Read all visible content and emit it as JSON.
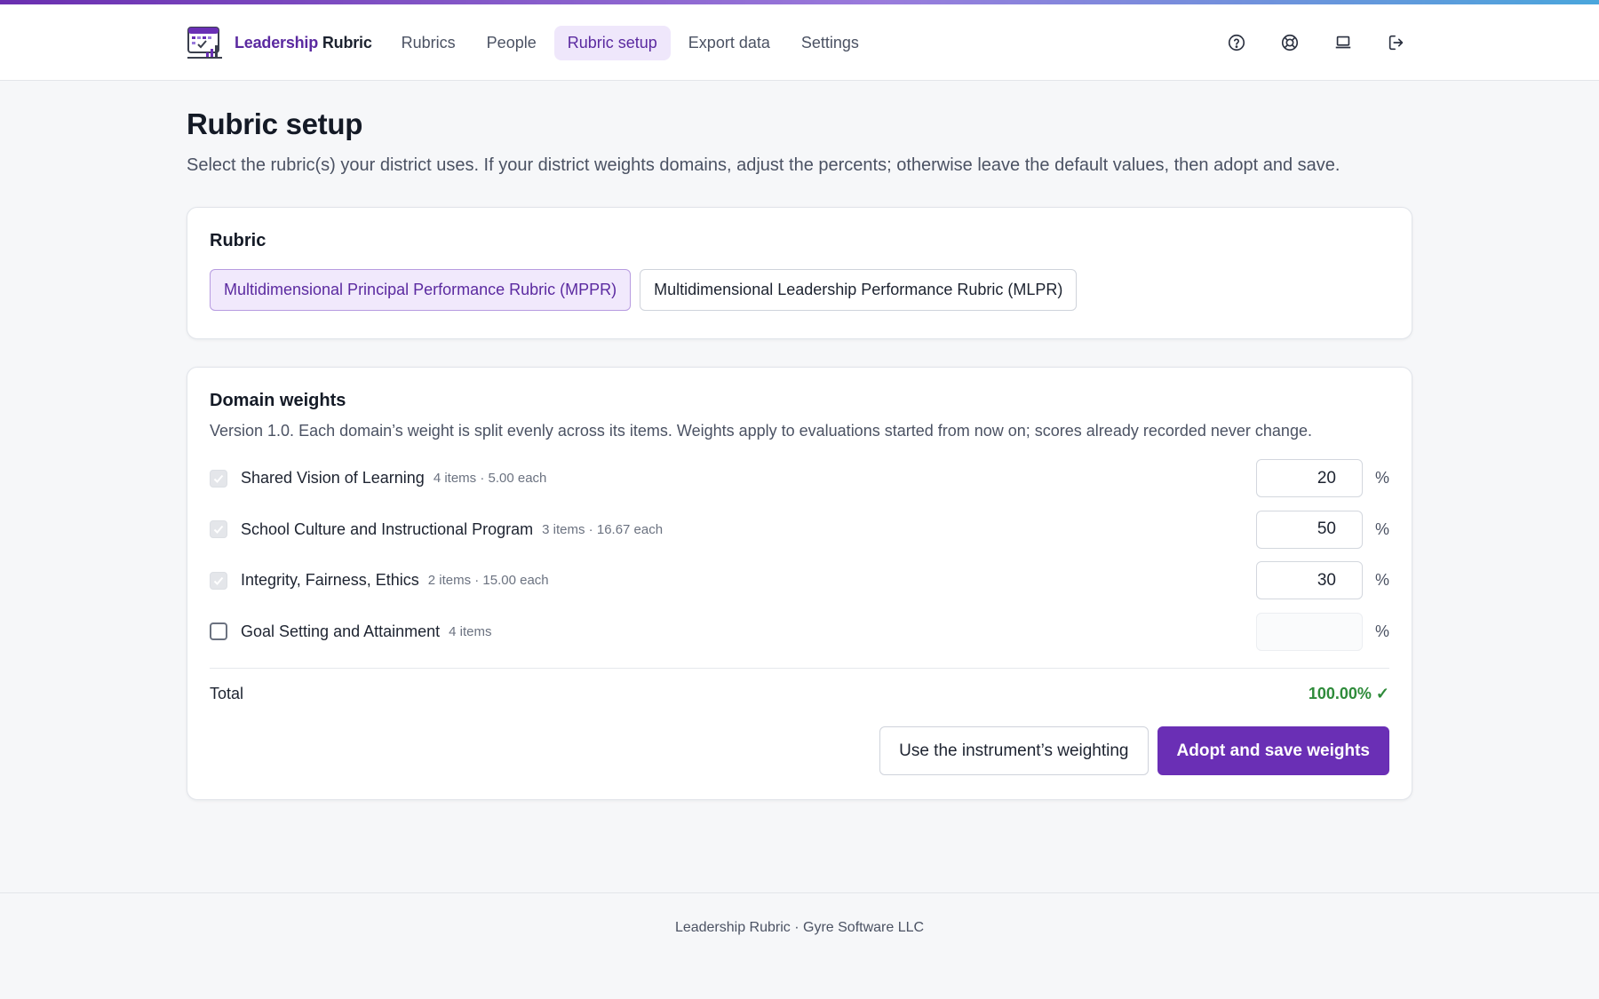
{
  "brand": {
    "name_part1": "Leadership",
    "name_part2": "Rubric",
    "logo_icon": "rubric-chart-logo"
  },
  "nav": {
    "items": [
      {
        "label": "Rubrics",
        "active": false
      },
      {
        "label": "People",
        "active": false
      },
      {
        "label": "Rubric setup",
        "active": true
      },
      {
        "label": "Export data",
        "active": false
      },
      {
        "label": "Settings",
        "active": false
      }
    ]
  },
  "header_icons": [
    "help-icon",
    "support-icon",
    "laptop-icon",
    "logout-icon"
  ],
  "page": {
    "title": "Rubric setup",
    "description": "Select the rubric(s) your district uses. If your district weights domains, adjust the percents; otherwise leave the default values, then adopt and save."
  },
  "rubric_card": {
    "title": "Rubric",
    "options": [
      {
        "label": "Multidimensional Principal Performance Rubric (MPPR)",
        "selected": true
      },
      {
        "label": "Multidimensional Leadership Performance Rubric (MLPR)",
        "selected": false
      }
    ]
  },
  "weights_card": {
    "title": "Domain weights",
    "description": "Version 1.0. Each domain’s weight is split evenly across its items. Weights apply to evaluations started from now on; scores already recorded never change.",
    "domains": [
      {
        "name": "Shared Vision of Learning",
        "meta": "4 items · 5.00 each",
        "checked": true,
        "weight": "20"
      },
      {
        "name": "School Culture and Instructional Program",
        "meta": "3 items · 16.67 each",
        "checked": true,
        "weight": "50"
      },
      {
        "name": "Integrity, Fairness, Ethics",
        "meta": "2 items · 15.00 each",
        "checked": true,
        "weight": "30"
      },
      {
        "name": "Goal Setting and Attainment",
        "meta": "4 items",
        "checked": false,
        "weight": ""
      }
    ],
    "percent_symbol": "%",
    "total_label": "Total",
    "total_value": "100.00% ✓",
    "secondary_button": "Use the instrument’s weighting",
    "primary_button": "Adopt and save weights"
  },
  "footer": {
    "text": "Leadership Rubric · Gyre Software LLC"
  },
  "colors": {
    "accent": "#6a2fb5",
    "accent_light": "#efe7fb",
    "success": "#2e8b3a"
  }
}
